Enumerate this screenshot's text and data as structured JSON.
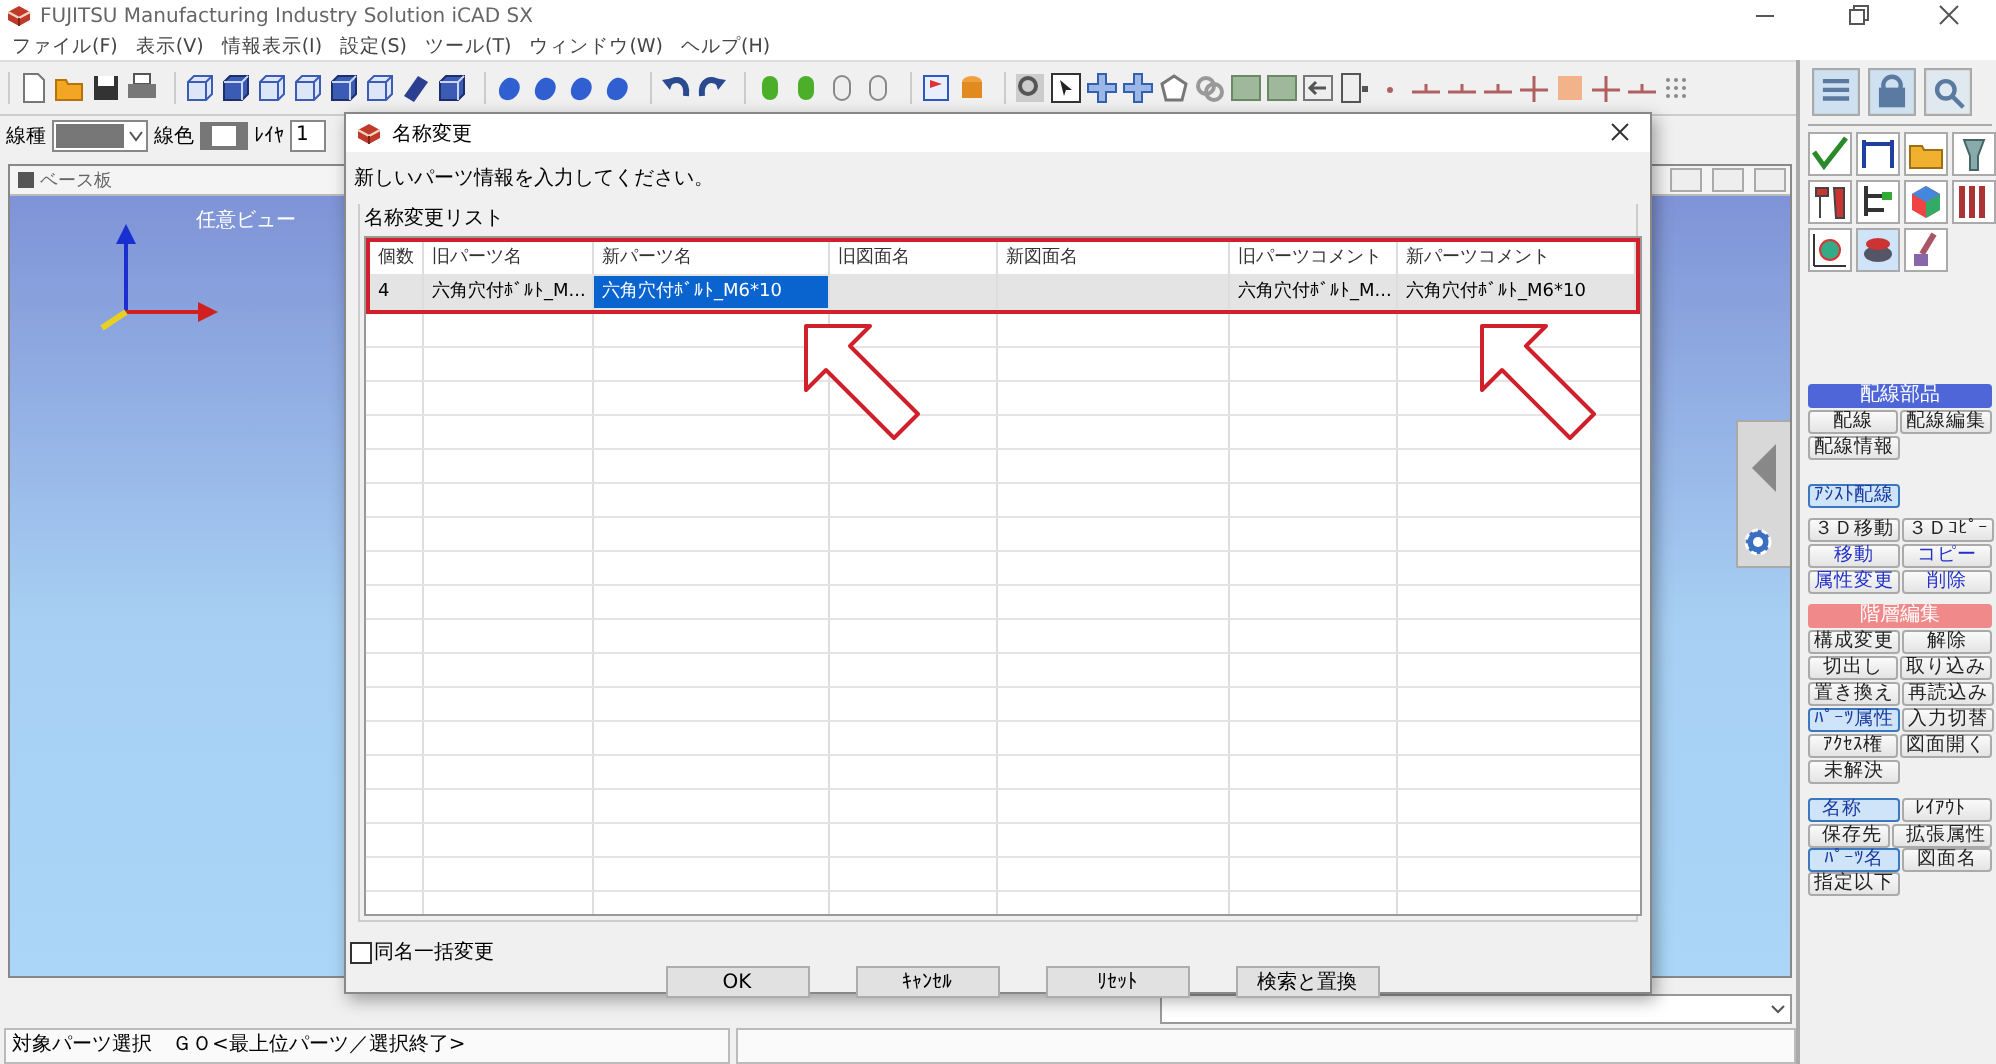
{
  "window": {
    "title": "FUJITSU Manufacturing Industry Solution iCAD SX"
  },
  "menu": [
    "ファイル(F)",
    "表示(V)",
    "情報表示(I)",
    "設定(S)",
    "ツール(T)",
    "ウィンドウ(W)",
    "ヘルプ(H)"
  ],
  "property_bar": {
    "line_type_label": "線種",
    "line_color_label": "線色",
    "layer_label": "ﾚｲﾔ",
    "layer_value": "1"
  },
  "view_window": {
    "title": "ベース板",
    "view_label": "任意ビュー"
  },
  "dialog": {
    "title": "名称変更",
    "message": "新しいパーツ情報を入力してください。",
    "group_label": "名称変更リスト",
    "columns": [
      "個数",
      "旧パーツ名",
      "新パーツ名",
      "旧図面名",
      "新図面名",
      "旧パーツコメント",
      "新パーツコメント"
    ],
    "rows": [
      {
        "cells": [
          {
            "text": "4",
            "selected": false
          },
          {
            "text": "六角穴付ﾎﾞﾙﾄ_M...",
            "selected": false
          },
          {
            "text": "六角穴付ﾎﾞﾙﾄ_M6*10",
            "selected": true
          },
          {
            "selected": false
          },
          {
            "selected": false
          },
          {
            "text": "六角穴付ﾎﾞﾙﾄ_M...",
            "selected": false
          },
          {
            "text": "六角穴付ﾎﾞﾙﾄ_M6*10",
            "selected": false
          }
        ]
      }
    ],
    "checkbox": {
      "label": "同名一括変更",
      "checked": false
    },
    "buttons": [
      "OK",
      "ｷｬﾝｾﾙ",
      "ﾘｾｯﾄ",
      "検索と置換"
    ]
  },
  "side_panel": {
    "sections": [
      {
        "header": {
          "label": "配線部品",
          "color": "#4f66d8"
        },
        "rows": [
          [
            {
              "label": "配線",
              "selected": false,
              "highlighted": false
            },
            {
              "label": "配線編集",
              "selected": false,
              "highlighted": false
            }
          ],
          [
            {
              "label": "配線情報",
              "selected": false,
              "highlighted": false
            }
          ]
        ]
      },
      {
        "rows": [
          [
            {
              "label": "ｱｼｽﾄ配線",
              "selected": true,
              "highlighted": false
            }
          ]
        ]
      },
      {
        "rows": [
          [
            {
              "label": "３Ｄ移動",
              "selected": false,
              "highlighted": false
            },
            {
              "label": "３Ｄｺﾋﾟｰ",
              "selected": false,
              "highlighted": false
            }
          ],
          [
            {
              "label": "移動",
              "selected": false,
              "highlighted": true
            },
            {
              "label": "コピー",
              "selected": false,
              "highlighted": true
            }
          ],
          [
            {
              "label": "属性変更",
              "selected": false,
              "highlighted": true
            },
            {
              "label": "削除",
              "selected": false,
              "highlighted": true
            }
          ]
        ]
      },
      {
        "header": {
          "label": "階層編集",
          "color": "#f08a8a"
        },
        "rows": [
          [
            {
              "label": "構成変更",
              "selected": false,
              "highlighted": false
            },
            {
              "label": "解除",
              "selected": false,
              "highlighted": false
            }
          ],
          [
            {
              "label": "切出し",
              "selected": false,
              "highlighted": false
            },
            {
              "label": "取り込み",
              "selected": false,
              "highlighted": false
            }
          ],
          [
            {
              "label": "置き換え",
              "selected": false,
              "highlighted": false
            },
            {
              "label": "再読込み",
              "selected": false,
              "highlighted": false
            }
          ],
          [
            {
              "label": "ﾊﾟｰﾂ属性",
              "selected": true,
              "highlighted": false
            },
            {
              "label": "入力切替",
              "selected": false,
              "highlighted": false
            }
          ],
          [
            {
              "label": "ｱｸｾｽ権",
              "selected": false,
              "highlighted": false
            },
            {
              "label": "図面開く",
              "selected": false,
              "highlighted": false
            }
          ],
          [
            {
              "label": "未解決",
              "selected": false,
              "highlighted": false
            }
          ]
        ]
      },
      {
        "rows": [
          [
            {
              "label": "名称",
              "selected": true,
              "highlighted": false
            },
            {
              "label": "ﾚｲｱｳﾄ",
              "selected": false,
              "highlighted": false
            }
          ],
          [
            {
              "label": "保存先",
              "selected": false,
              "highlighted": false
            },
            {
              "label": "拡張属性",
              "selected": false,
              "highlighted": false
            }
          ]
        ]
      },
      {
        "rows": [
          [
            {
              "label": "ﾊﾟｰﾂ名",
              "selected": true,
              "highlighted": false
            },
            {
              "label": "図面名",
              "selected": false,
              "highlighted": false
            }
          ]
        ]
      },
      {
        "rows": [
          [
            {
              "label": "指定以下",
              "selected": false,
              "highlighted": false
            }
          ]
        ]
      }
    ]
  },
  "status_bar": {
    "text": "対象パーツ選択　ＧＯ<最上位パーツ／選択終了>"
  }
}
